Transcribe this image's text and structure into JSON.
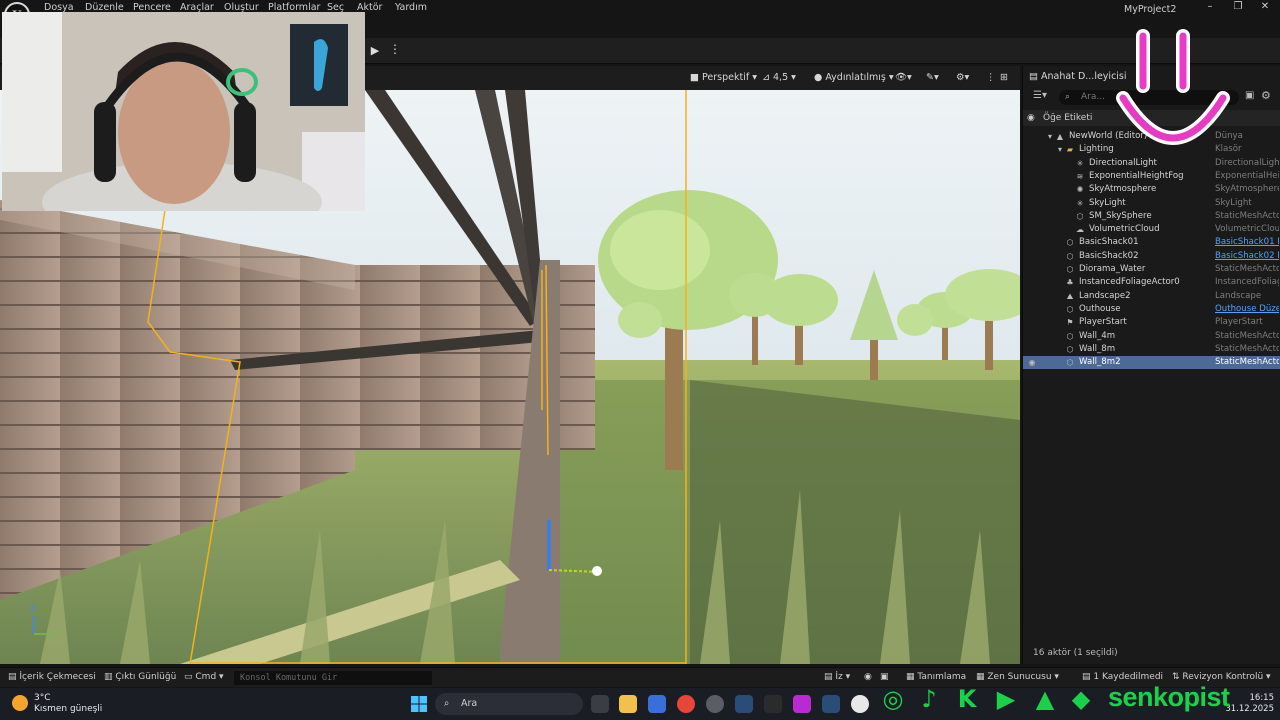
{
  "menubar": {
    "logo": "U",
    "items": [
      "Dosya",
      "Düzenle",
      "Pencere",
      "Araçlar",
      "Oluştur",
      "Platformlar",
      "Seç",
      "Aktör",
      "Yardım"
    ],
    "project": "MyProject2"
  },
  "viewport": {
    "perspective": "Perspektif",
    "fov": "4,5",
    "lighting": "Aydınlatılmış",
    "axis_z": "Z",
    "axis_y": "Y"
  },
  "outliner": {
    "tab_title": "Anahat D...leyicisi",
    "search_placeholder": "Ara...",
    "column_label": "Öğe Etiketi",
    "rows": [
      {
        "label": "NewWorld (Editor)",
        "type": "Dünya",
        "link": false,
        "indent": 0,
        "icon": "world-icon"
      },
      {
        "label": "Lighting",
        "type": "Klasör",
        "link": false,
        "indent": 1,
        "icon": "folder-icon"
      },
      {
        "label": "DirectionalLight",
        "type": "DirectionalLight",
        "link": false,
        "indent": 2,
        "icon": "light-icon"
      },
      {
        "label": "ExponentialHeightFog",
        "type": "ExponentialHeigh",
        "link": false,
        "indent": 2,
        "icon": "fog-icon"
      },
      {
        "label": "SkyAtmosphere",
        "type": "SkyAtmosphere",
        "link": false,
        "indent": 2,
        "icon": "sky-icon"
      },
      {
        "label": "SkyLight",
        "type": "SkyLight",
        "link": false,
        "indent": 2,
        "icon": "light-icon"
      },
      {
        "label": "SM_SkySphere",
        "type": "StaticMeshActor",
        "link": false,
        "indent": 2,
        "icon": "mesh-icon"
      },
      {
        "label": "VolumetricCloud",
        "type": "VolumetricCloud",
        "link": false,
        "indent": 2,
        "icon": "cloud-icon"
      },
      {
        "label": "BasicShack01",
        "type": "BasicShack01 D",
        "link": true,
        "indent": 1,
        "icon": "mesh-icon"
      },
      {
        "label": "BasicShack02",
        "type": "BasicShack02 D",
        "link": true,
        "indent": 1,
        "icon": "mesh-icon"
      },
      {
        "label": "Diorama_Water",
        "type": "StaticMeshActor",
        "link": false,
        "indent": 1,
        "icon": "mesh-icon"
      },
      {
        "label": "InstancedFoliageActor0",
        "type": "InstancedFoliage",
        "link": false,
        "indent": 1,
        "icon": "foliage-icon"
      },
      {
        "label": "Landscape2",
        "type": "Landscape",
        "link": false,
        "indent": 1,
        "icon": "landscape-icon"
      },
      {
        "label": "Outhouse",
        "type": "Outhouse Düzer",
        "link": true,
        "indent": 1,
        "icon": "mesh-icon"
      },
      {
        "label": "PlayerStart",
        "type": "PlayerStart",
        "link": false,
        "indent": 1,
        "icon": "flag-icon"
      },
      {
        "label": "Wall_4m",
        "type": "StaticMeshActor",
        "link": false,
        "indent": 1,
        "icon": "mesh-icon"
      },
      {
        "label": "Wall_8m",
        "type": "StaticMeshActor",
        "link": false,
        "indent": 1,
        "icon": "mesh-icon"
      },
      {
        "label": "Wall_8m2",
        "type": "StaticMeshActor",
        "link": false,
        "indent": 1,
        "icon": "mesh-icon",
        "selected": true
      }
    ],
    "footer": "16 aktör (1 seçildi)"
  },
  "statusbar": {
    "content_drawer": "İçerik Çekmecesi",
    "output_log": "Çıktı Günlüğü",
    "cmd": "Cmd",
    "console_placeholder": "Konsol Komutunu Gir",
    "iz": "İz",
    "tanimlama": "Tanımlama",
    "zen": "Zen Sunucusu",
    "unsaved": "1 Kaydedilmedi",
    "revision": "Revizyon Kontrolü"
  },
  "taskbar": {
    "temperature": "3°C",
    "weather": "Kısmen güneşli",
    "search": "Ara",
    "time": "16:15",
    "date": "31.12.2025"
  },
  "overlay": {
    "channel": "senkopist"
  },
  "colors": {
    "selection": "#4c6a95",
    "link": "#4ea3ff",
    "wall_outline": "#f2b21b",
    "brand_green": "#1ad24a",
    "smiley": "#e83ac4"
  }
}
